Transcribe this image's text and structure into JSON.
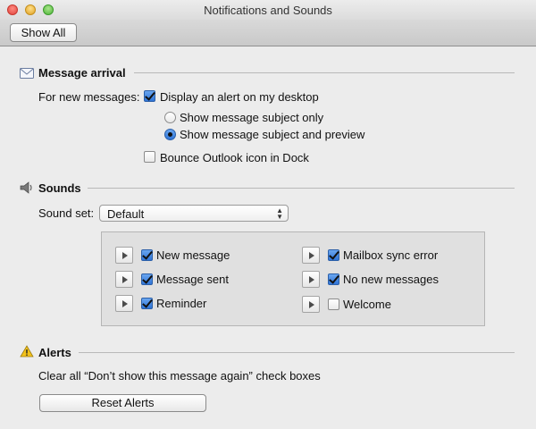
{
  "window": {
    "title": "Notifications and Sounds"
  },
  "toolbar": {
    "show_all": "Show All"
  },
  "message_arrival": {
    "title": "Message arrival",
    "icon": "envelope-icon",
    "for_new_label": "For new messages:",
    "display_alert": {
      "label": "Display an alert on my desktop",
      "checked": true
    },
    "radio_subject_only": {
      "label": "Show message subject only",
      "selected": false
    },
    "radio_subject_preview": {
      "label": "Show message subject and preview",
      "selected": true
    },
    "bounce_icon": {
      "label": "Bounce Outlook icon in Dock",
      "checked": false
    }
  },
  "sounds": {
    "title": "Sounds",
    "icon": "speaker-icon",
    "sound_set_label": "Sound set:",
    "sound_set_value": "Default",
    "items": [
      {
        "label": "New message",
        "checked": true
      },
      {
        "label": "Message sent",
        "checked": true
      },
      {
        "label": "Reminder",
        "checked": true
      },
      {
        "label": "Mailbox sync error",
        "checked": true
      },
      {
        "label": "No new messages",
        "checked": true
      },
      {
        "label": "Welcome",
        "checked": false
      }
    ]
  },
  "alerts": {
    "title": "Alerts",
    "icon": "warning-icon",
    "description": "Clear all “Don’t show this message again” check boxes",
    "reset_button": "Reset Alerts"
  }
}
